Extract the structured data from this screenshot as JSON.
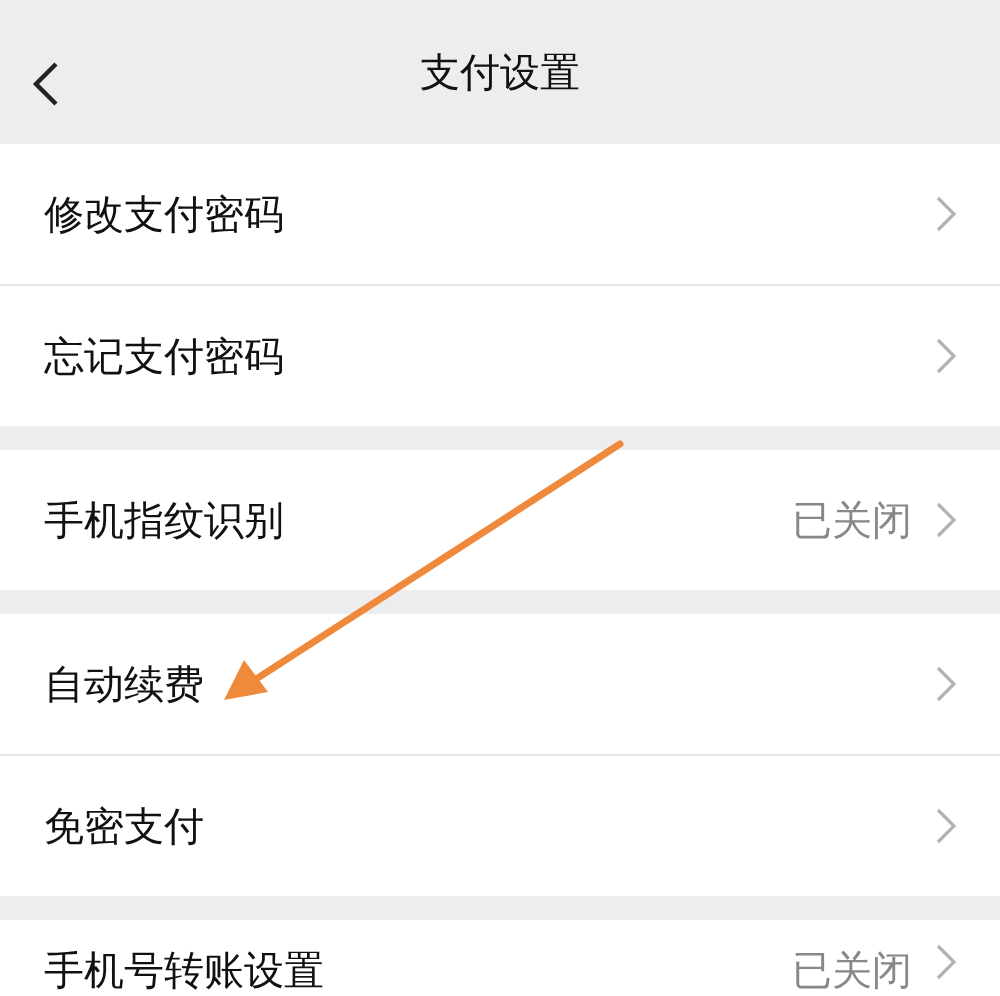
{
  "header": {
    "title": "支付设置"
  },
  "sections": [
    {
      "items": [
        {
          "label": "修改支付密码"
        },
        {
          "label": "忘记支付密码"
        }
      ]
    },
    {
      "items": [
        {
          "label": "手机指纹识别",
          "value": "已关闭"
        }
      ]
    },
    {
      "items": [
        {
          "label": "自动续费"
        },
        {
          "label": "免密支付"
        }
      ]
    },
    {
      "items": [
        {
          "label": "手机号转账设置",
          "value": "已关闭"
        }
      ]
    }
  ]
}
